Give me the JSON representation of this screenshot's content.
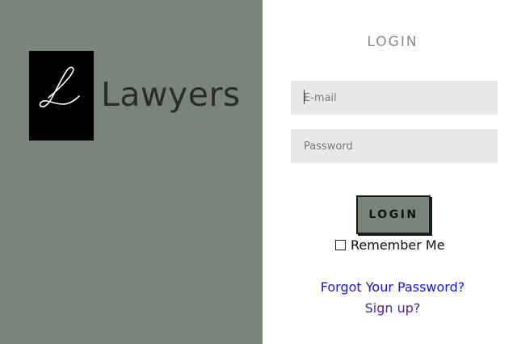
{
  "brand": {
    "logo_letter": "L",
    "name": "Lawyers"
  },
  "login": {
    "heading": "LOGIN",
    "email_placeholder": "E-mail",
    "password_placeholder": "Password",
    "button_label": "LOGIN",
    "remember_label": "Remember Me",
    "remember_checked": false,
    "forgot_link": "Forgot Your Password?",
    "signup_link": "Sign up?"
  },
  "colors": {
    "panel_green": "#79857a",
    "field_bg": "#eae8e8",
    "link_blue": "#1a14d8",
    "link_purple": "#4b2a9a"
  }
}
